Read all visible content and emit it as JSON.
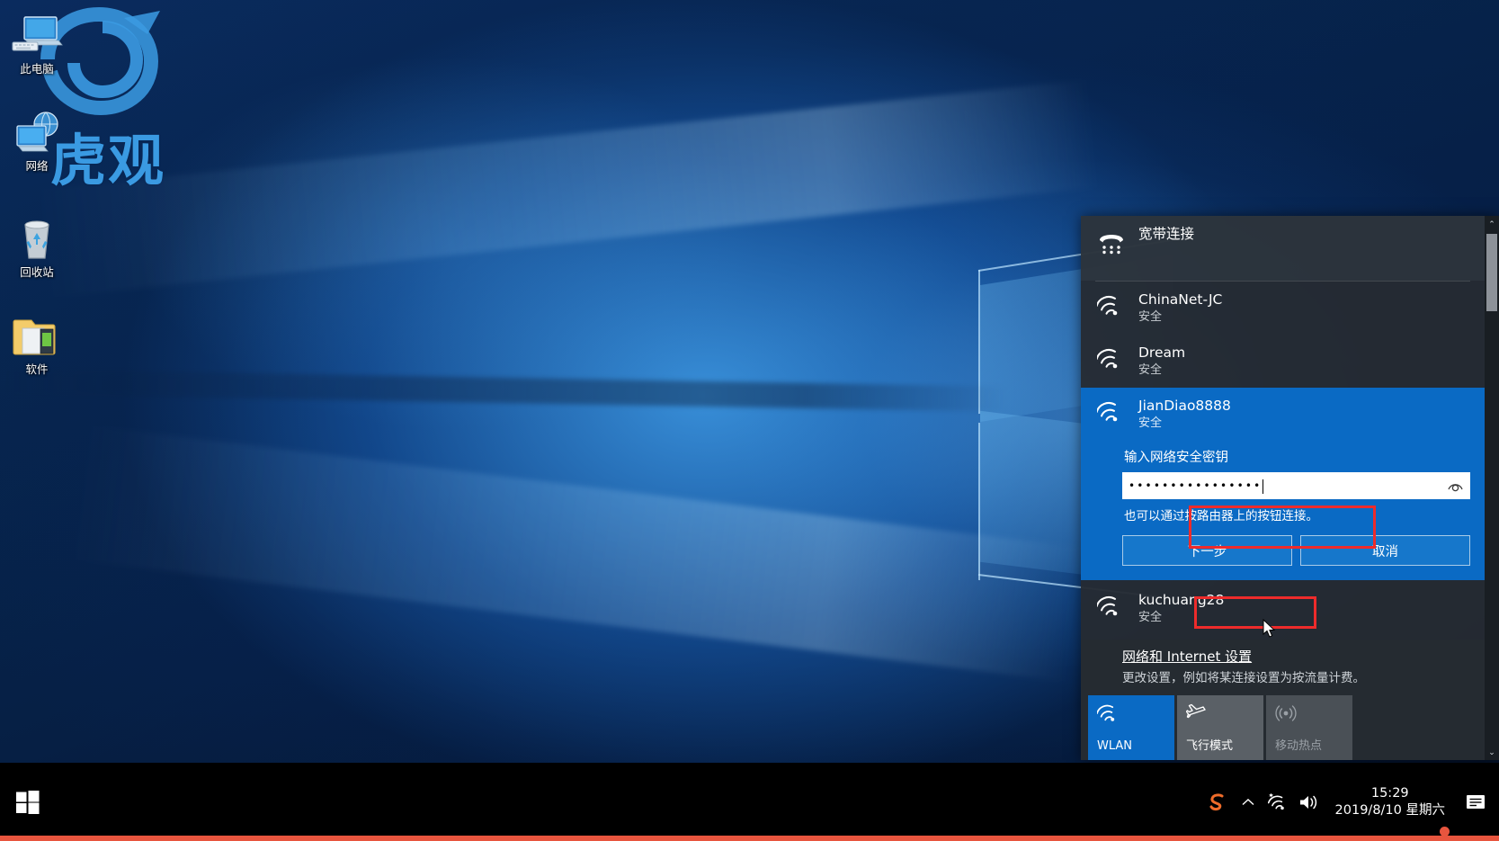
{
  "desktop": {
    "watermark_text": "虎观",
    "icons": [
      {
        "name": "this-pc",
        "label": "此电脑",
        "icon": "computer-icon"
      },
      {
        "name": "network",
        "label": "网络",
        "icon": "network-globe-icon"
      },
      {
        "name": "recycle-bin",
        "label": "回收站",
        "icon": "recycle-bin-icon"
      },
      {
        "name": "software",
        "label": "软件",
        "icon": "folder-icon"
      }
    ]
  },
  "network_panel": {
    "broadband": {
      "name": "宽带连接",
      "icon": "dialup-icon"
    },
    "networks": [
      {
        "ssid": "ChinaNet-JC",
        "status": "安全",
        "icon": "wifi-icon",
        "selected": false
      },
      {
        "ssid": "Dream",
        "status": "安全",
        "icon": "wifi-icon",
        "selected": false
      },
      {
        "ssid": "JianDiao8888",
        "status": "安全",
        "icon": "wifi-icon",
        "selected": true
      },
      {
        "ssid": "kuchuang28",
        "status": "安全",
        "icon": "wifi-icon",
        "selected": false
      }
    ],
    "connect_form": {
      "password_label": "输入网络安全密钥",
      "password_value": "••••••••••••••••",
      "password_placeholder": "",
      "eye_icon": "show-password-eye-icon",
      "hint": "也可以通过按路由器上的按钮连接。",
      "next_button": "下一步",
      "cancel_button": "取消"
    },
    "settings_link": "网络和 Internet 设置",
    "settings_sub": "更改设置，例如将某连接设置为按流量计费。",
    "tiles": [
      {
        "label": "WLAN",
        "icon": "wifi-icon",
        "state": "on"
      },
      {
        "label": "飞行模式",
        "icon": "airplane-icon",
        "state": "off"
      },
      {
        "label": "移动热点",
        "icon": "hotspot-icon",
        "state": "disabled"
      }
    ],
    "scrollbar": {
      "up_arrow": "⌃",
      "down_arrow": "⌄"
    }
  },
  "taskbar": {
    "start_icon": "windows-start-icon",
    "tray": [
      {
        "name": "sogou-input-icon",
        "glyph": "S"
      },
      {
        "name": "show-hidden-icons-chevron",
        "glyph": "⌃"
      },
      {
        "name": "wifi-tray-icon",
        "glyph": ""
      },
      {
        "name": "volume-icon",
        "glyph": ""
      }
    ],
    "clock_time": "15:29",
    "clock_date": "2019/8/10 星期六",
    "notification_icon": "action-center-icon"
  },
  "colors": {
    "accent_blue": "#0a6ac4",
    "panel_dark": "#2b3137",
    "annotation_red": "#ee2b2b",
    "taskbar_black": "#000000",
    "bottom_bar_red": "#e8553e"
  }
}
